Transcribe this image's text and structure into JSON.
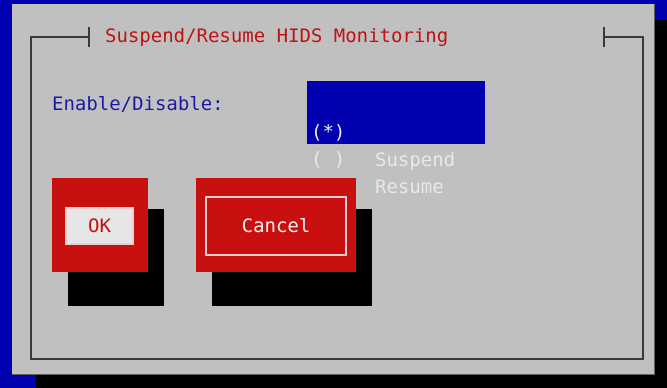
{
  "dialog": {
    "title": "Suspend/Resume HIDS Monitoring",
    "field_label": "Enable/Disable:",
    "options": [
      {
        "mark": "(*)",
        "label": "Suspend",
        "selected": true
      },
      {
        "mark": "( )",
        "label": "Resume",
        "selected": false
      }
    ],
    "buttons": {
      "ok_label": "OK",
      "cancel_label": "Cancel"
    }
  },
  "colors": {
    "background": "#0000b0",
    "dialog": "#c0c0c0",
    "accent": "#c81010",
    "text_blue": "#1a1aa0"
  }
}
